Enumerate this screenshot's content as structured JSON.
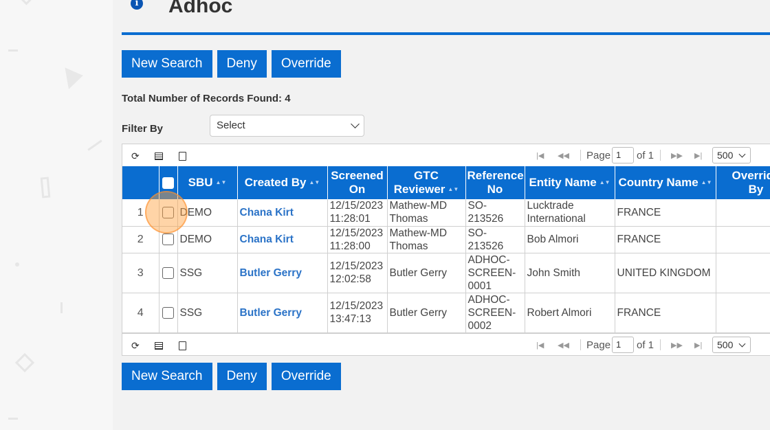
{
  "header": {
    "title": "Adhoc",
    "info_icon": "info-icon"
  },
  "actions": {
    "new_search": "New Search",
    "deny": "Deny",
    "override": "Override"
  },
  "records_label": "Total Number of Records Found: 4",
  "filter": {
    "label": "Filter By",
    "selected": "Select"
  },
  "pager": {
    "page_label": "Page",
    "page_value": "1",
    "of_label": "of 1",
    "page_size": "500"
  },
  "table": {
    "columns": {
      "sbu": "SBU",
      "created_by": "Created By",
      "screened_on_1": "Screened",
      "screened_on_2": "On",
      "gtc_reviewer_1": "GTC",
      "gtc_reviewer_2": "Reviewer",
      "reference_no_1": "Reference",
      "reference_no_2": "No",
      "entity_name": "Entity Name",
      "country_name": "Country Name",
      "override_by_1": "Override",
      "override_by_2": "By"
    },
    "rows": [
      {
        "num": "1",
        "sbu": "DEMO",
        "created_by": "Chana Kirt",
        "screened_date": "12/15/2023",
        "screened_time": "11:28:01",
        "gtc_1": "Mathew-MD",
        "gtc_2": "Thomas",
        "ref_1": "SO-213526",
        "ref_2": "",
        "ref_3": "",
        "entity_1": "Lucktrade",
        "entity_2": "International",
        "country": "FRANCE"
      },
      {
        "num": "2",
        "sbu": "DEMO",
        "created_by": "Chana Kirt",
        "screened_date": "12/15/2023",
        "screened_time": "11:28:00",
        "gtc_1": "Mathew-MD",
        "gtc_2": "Thomas",
        "ref_1": "SO-213526",
        "ref_2": "",
        "ref_3": "",
        "entity_1": "Bob Almori",
        "entity_2": "",
        "country": "FRANCE"
      },
      {
        "num": "3",
        "sbu": "SSG",
        "created_by": "Butler Gerry",
        "screened_date": "12/15/2023",
        "screened_time": "12:02:58",
        "gtc_1": "Butler Gerry",
        "gtc_2": "",
        "ref_1": "ADHOC-",
        "ref_2": "SCREEN-",
        "ref_3": "0001",
        "entity_1": "John Smith",
        "entity_2": "",
        "country": "UNITED KINGDOM"
      },
      {
        "num": "4",
        "sbu": "SSG",
        "created_by": "Butler Gerry",
        "screened_date": "12/15/2023",
        "screened_time": "13:47:13",
        "gtc_1": "Butler Gerry",
        "gtc_2": "",
        "ref_1": "ADHOC-",
        "ref_2": "SCREEN-",
        "ref_3": "0002",
        "entity_1": "Robert Almori",
        "entity_2": "",
        "country": "FRANCE"
      }
    ]
  },
  "colors": {
    "primary": "#0a6dd0",
    "link": "#2b73c7",
    "highlight": "#ffa03c"
  }
}
